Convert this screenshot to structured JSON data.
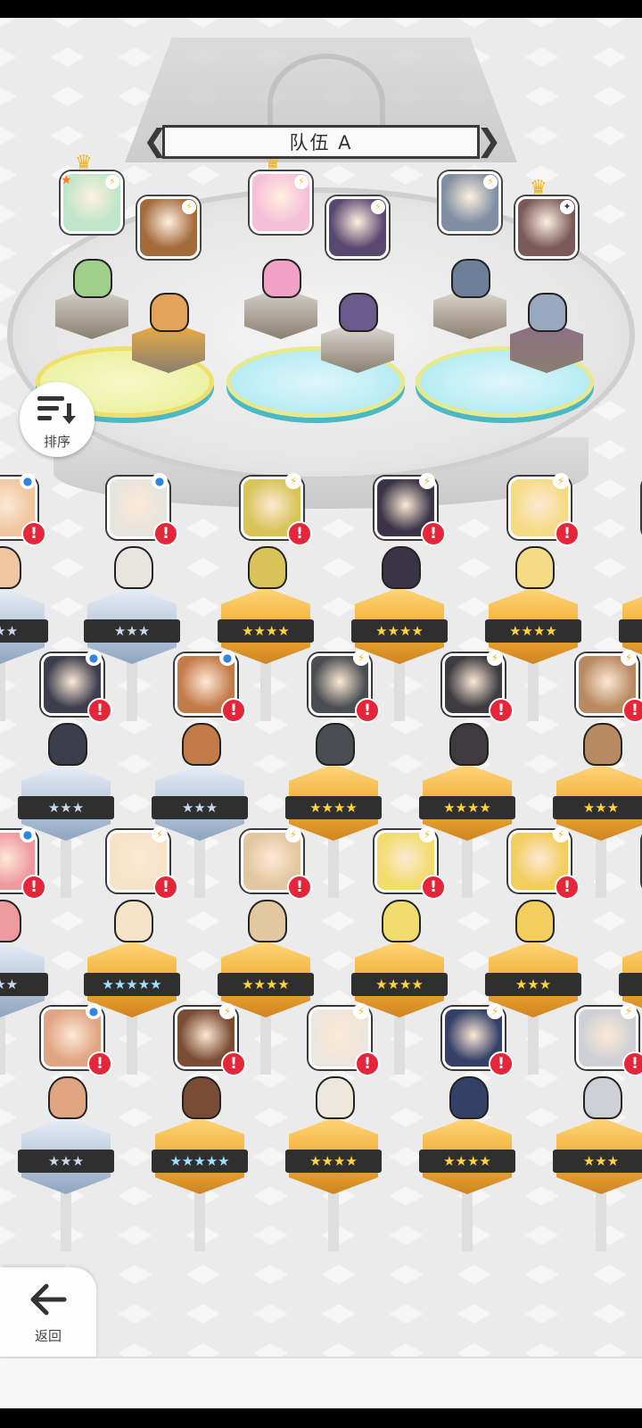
{
  "team": {
    "title": "队伍 A",
    "members": [
      {
        "id": "m1",
        "crown": true,
        "badge": "star",
        "type": "bolt",
        "skin": "#bfe6c8",
        "pedestal": "#d9d6cf",
        "chibi": "#9fcf8a"
      },
      {
        "id": "m2",
        "crown": false,
        "badge": "",
        "type": "bolt",
        "skin": "#a36a3a",
        "pedestal": "#f0b040",
        "chibi": "#e3a35a"
      },
      {
        "id": "m3",
        "crown": true,
        "badge": "",
        "type": "bolt",
        "skin": "#f6bfd8",
        "pedestal": "#d9d6cf",
        "chibi": "#f2a2c6"
      },
      {
        "id": "m4",
        "crown": false,
        "badge": "",
        "type": "bolt",
        "skin": "#5a4770",
        "pedestal": "#e3e0da",
        "chibi": "#6b5a8c"
      },
      {
        "id": "m5",
        "crown": false,
        "badge": "",
        "type": "bolt",
        "skin": "#7f8ea2",
        "pedestal": "#e3ddd3",
        "chibi": "#6d7f99"
      },
      {
        "id": "m6",
        "crown": true,
        "badge": "",
        "type": "dark",
        "skin": "#7a5a58",
        "pedestal": "#8e6e86",
        "chibi": "#9aa9c0"
      }
    ]
  },
  "sort": {
    "label": "排序"
  },
  "back": {
    "label": "返回"
  },
  "roster": [
    [
      {
        "stars": "★★★",
        "tier": "silver",
        "type": "water",
        "color": "#f0c6a0"
      },
      {
        "stars": "★★★",
        "tier": "silver",
        "type": "water",
        "color": "#e8e4de"
      },
      {
        "stars": "★★★★",
        "tier": "gold",
        "type": "bolt",
        "color": "#d9c45a"
      },
      {
        "stars": "★★★★",
        "tier": "gold",
        "type": "bolt",
        "color": "#3a3446"
      },
      {
        "stars": "★★★★",
        "tier": "gold",
        "type": "bolt",
        "color": "#f6db86"
      },
      {
        "stars": "★★★",
        "tier": "gold",
        "type": "bolt",
        "color": "#d8a36a"
      }
    ],
    [
      {
        "stars": "★★★",
        "tier": "silver",
        "type": "water",
        "color": "#3c3e4e"
      },
      {
        "stars": "★★★",
        "tier": "silver",
        "type": "water",
        "color": "#c47b4a"
      },
      {
        "stars": "★★★★",
        "tier": "gold",
        "type": "bolt",
        "color": "#4a4e52"
      },
      {
        "stars": "★★★★",
        "tier": "gold",
        "type": "bolt",
        "color": "#3d3b40"
      },
      {
        "stars": "★★★",
        "tier": "gold",
        "type": "bolt",
        "color": "#b88a62"
      }
    ],
    [
      {
        "stars": "★★★",
        "tier": "silver",
        "type": "water",
        "color": "#f09aa0"
      },
      {
        "stars": "★★★★★",
        "tier": "rainbow",
        "type": "bolt",
        "color": "#f6e4c8"
      },
      {
        "stars": "★★★★",
        "tier": "gold",
        "type": "bolt",
        "color": "#e3c7a0"
      },
      {
        "stars": "★★★★",
        "tier": "gold",
        "type": "bolt",
        "color": "#f1dd6e"
      },
      {
        "stars": "★★★",
        "tier": "gold",
        "type": "bolt",
        "color": "#f3cd5e"
      },
      {
        "stars": "★★★",
        "tier": "gold",
        "type": "bolt",
        "color": "#d8a36a"
      }
    ],
    [
      {
        "stars": "★★★",
        "tier": "silver",
        "type": "water",
        "color": "#e0a582"
      },
      {
        "stars": "★★★★★",
        "tier": "rainbow",
        "type": "bolt",
        "color": "#7a4c35"
      },
      {
        "stars": "★★★★",
        "tier": "gold",
        "type": "bolt",
        "color": "#ede6dc"
      },
      {
        "stars": "★★★★",
        "tier": "gold",
        "type": "bolt",
        "color": "#344066"
      },
      {
        "stars": "★★★",
        "tier": "gold",
        "type": "bolt",
        "color": "#cfd0d6"
      }
    ]
  ]
}
